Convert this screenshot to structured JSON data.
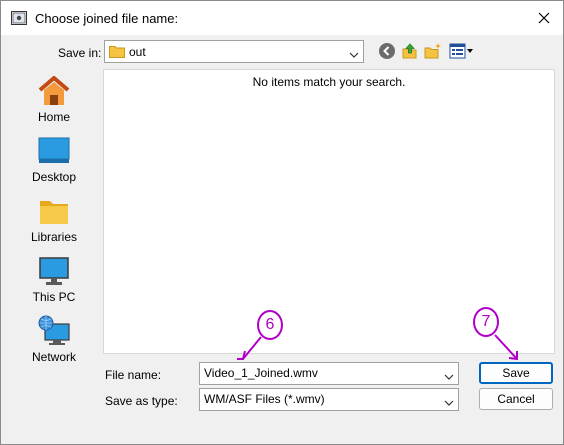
{
  "window": {
    "title": "Choose joined file name:"
  },
  "toolbar": {
    "save_in_label": "Save in:",
    "save_in_value": "out",
    "icons": [
      "back-icon",
      "up-folder-icon",
      "new-folder-icon",
      "view-menu-icon"
    ]
  },
  "places": [
    {
      "label": "Home",
      "icon": "home-icon"
    },
    {
      "label": "Desktop",
      "icon": "desktop-icon"
    },
    {
      "label": "Libraries",
      "icon": "libraries-icon"
    },
    {
      "label": "This PC",
      "icon": "this-pc-icon"
    },
    {
      "label": "Network",
      "icon": "network-icon"
    }
  ],
  "file_list": {
    "empty_message": "No items match your search."
  },
  "form": {
    "file_name_label": "File name:",
    "file_name_value": "Video_1_Joined.wmv",
    "save_as_type_label": "Save as type:",
    "save_as_type_value": "WM/ASF Files (*.wmv)"
  },
  "buttons": {
    "save": "Save",
    "cancel": "Cancel"
  },
  "annotations": [
    {
      "number": "6",
      "target": "file-name-field"
    },
    {
      "number": "7",
      "target": "save-button"
    }
  ],
  "colors": {
    "annotation": "#b000c8",
    "accent": "#0067c0"
  }
}
